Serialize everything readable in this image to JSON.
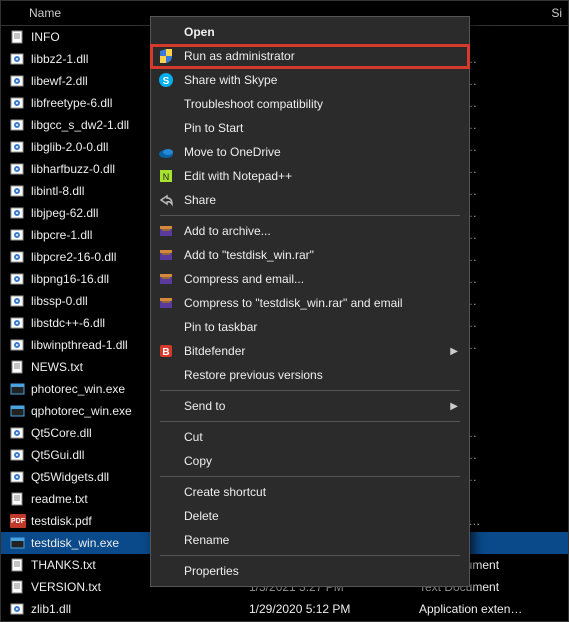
{
  "header": {
    "name": "Name",
    "date": "",
    "type": "",
    "size": "Si"
  },
  "files": [
    {
      "icon": "txt",
      "name": "INFO",
      "date": "",
      "type": ""
    },
    {
      "icon": "dll",
      "name": "libbz2-1.dll",
      "date": "",
      "type": "on exten…"
    },
    {
      "icon": "dll",
      "name": "libewf-2.dll",
      "date": "",
      "type": "on exten…"
    },
    {
      "icon": "dll",
      "name": "libfreetype-6.dll",
      "date": "",
      "type": "on exten…"
    },
    {
      "icon": "dll",
      "name": "libgcc_s_dw2-1.dll",
      "date": "",
      "type": "on exten…"
    },
    {
      "icon": "dll",
      "name": "libglib-2.0-0.dll",
      "date": "",
      "type": "on exten…"
    },
    {
      "icon": "dll",
      "name": "libharfbuzz-0.dll",
      "date": "",
      "type": "on exten…"
    },
    {
      "icon": "dll",
      "name": "libintl-8.dll",
      "date": "",
      "type": "on exten…"
    },
    {
      "icon": "dll",
      "name": "libjpeg-62.dll",
      "date": "",
      "type": "on exten…"
    },
    {
      "icon": "dll",
      "name": "libpcre-1.dll",
      "date": "",
      "type": "on exten…"
    },
    {
      "icon": "dll",
      "name": "libpcre2-16-0.dll",
      "date": "",
      "type": "on exten…"
    },
    {
      "icon": "dll",
      "name": "libpng16-16.dll",
      "date": "",
      "type": "on exten…"
    },
    {
      "icon": "dll",
      "name": "libssp-0.dll",
      "date": "",
      "type": "on exten…"
    },
    {
      "icon": "dll",
      "name": "libstdc++-6.dll",
      "date": "",
      "type": "on exten…"
    },
    {
      "icon": "dll",
      "name": "libwinpthread-1.dll",
      "date": "",
      "type": "on exten…"
    },
    {
      "icon": "txt",
      "name": "NEWS.txt",
      "date": "",
      "type": "ument"
    },
    {
      "icon": "exe",
      "name": "photorec_win.exe",
      "date": "",
      "type": "on"
    },
    {
      "icon": "exe",
      "name": "qphotorec_win.exe",
      "date": "",
      "type": "on"
    },
    {
      "icon": "dll",
      "name": "Qt5Core.dll",
      "date": "",
      "type": "on exten…"
    },
    {
      "icon": "dll",
      "name": "Qt5Gui.dll",
      "date": "",
      "type": "on exten…"
    },
    {
      "icon": "dll",
      "name": "Qt5Widgets.dll",
      "date": "",
      "type": "on exten…"
    },
    {
      "icon": "txt",
      "name": "readme.txt",
      "date": "",
      "type": "ument"
    },
    {
      "icon": "pdf",
      "name": "testdisk.pdf",
      "date": "",
      "type": "ft Edge P…"
    },
    {
      "icon": "exe",
      "name": "testdisk_win.exe",
      "date": "",
      "type": "on",
      "selected": true
    },
    {
      "icon": "txt",
      "name": "THANKS.txt",
      "date": "1/3/2021 3:27 PM",
      "type": "Text Document"
    },
    {
      "icon": "txt",
      "name": "VERSION.txt",
      "date": "1/3/2021 3:27 PM",
      "type": "Text Document"
    },
    {
      "icon": "dll",
      "name": "zlib1.dll",
      "date": "1/29/2020 5:12 PM",
      "type": "Application exten…"
    }
  ],
  "menu": [
    {
      "type": "item",
      "icon": "",
      "label": "Open",
      "bold": true
    },
    {
      "type": "item",
      "icon": "shield",
      "label": "Run as administrator"
    },
    {
      "type": "item",
      "icon": "skype",
      "label": "Share with Skype"
    },
    {
      "type": "item",
      "icon": "",
      "label": "Troubleshoot compatibility"
    },
    {
      "type": "item",
      "icon": "",
      "label": "Pin to Start"
    },
    {
      "type": "item",
      "icon": "onedrive",
      "label": "Move to OneDrive"
    },
    {
      "type": "item",
      "icon": "notepadpp",
      "label": "Edit with Notepad++"
    },
    {
      "type": "item",
      "icon": "share",
      "label": "Share"
    },
    {
      "type": "sep"
    },
    {
      "type": "item",
      "icon": "winrar",
      "label": "Add to archive..."
    },
    {
      "type": "item",
      "icon": "winrar",
      "label": "Add to \"testdisk_win.rar\""
    },
    {
      "type": "item",
      "icon": "winrar",
      "label": "Compress and email..."
    },
    {
      "type": "item",
      "icon": "winrar",
      "label": "Compress to \"testdisk_win.rar\" and email"
    },
    {
      "type": "item",
      "icon": "",
      "label": "Pin to taskbar"
    },
    {
      "type": "item",
      "icon": "bitdefender",
      "label": "Bitdefender",
      "submenu": true
    },
    {
      "type": "item",
      "icon": "",
      "label": "Restore previous versions"
    },
    {
      "type": "sep"
    },
    {
      "type": "item",
      "icon": "",
      "label": "Send to",
      "submenu": true
    },
    {
      "type": "sep"
    },
    {
      "type": "item",
      "icon": "",
      "label": "Cut"
    },
    {
      "type": "item",
      "icon": "",
      "label": "Copy"
    },
    {
      "type": "sep"
    },
    {
      "type": "item",
      "icon": "",
      "label": "Create shortcut"
    },
    {
      "type": "item",
      "icon": "",
      "label": "Delete"
    },
    {
      "type": "item",
      "icon": "",
      "label": "Rename"
    },
    {
      "type": "sep"
    },
    {
      "type": "item",
      "icon": "",
      "label": "Properties"
    }
  ],
  "watermark": ""
}
